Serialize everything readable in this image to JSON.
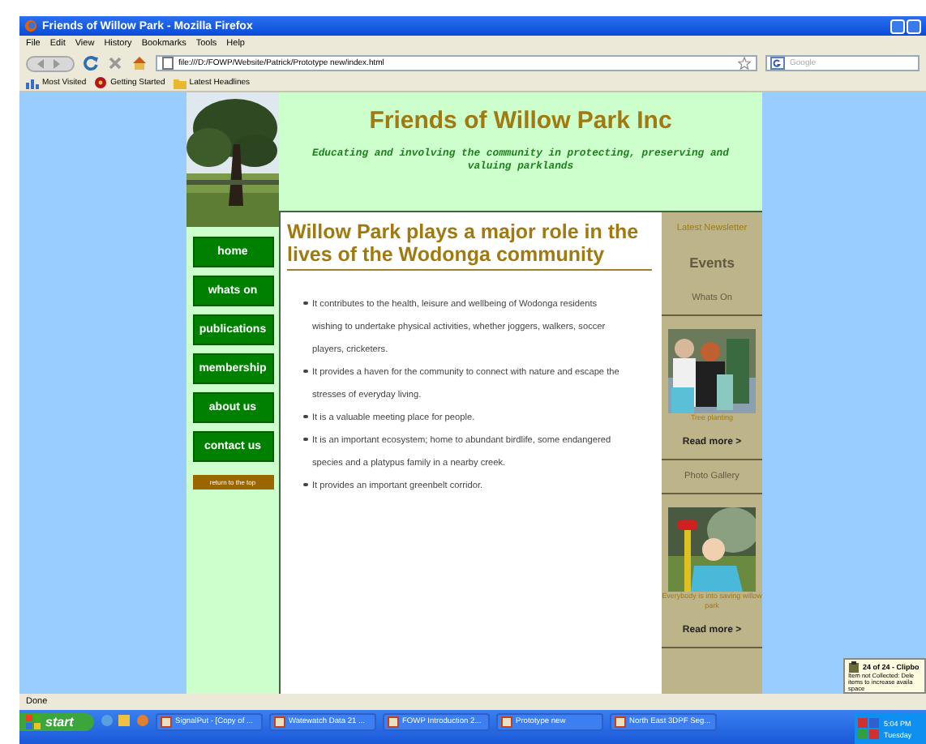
{
  "window": {
    "title": "Friends of Willow Park - Mozilla Firefox"
  },
  "menu": [
    "File",
    "Edit",
    "View",
    "History",
    "Bookmarks",
    "Tools",
    "Help"
  ],
  "address": {
    "value": "file:///D:/FOWP/Website/Patrick/Prototype new/index.html"
  },
  "search": {
    "placeholder": "Google"
  },
  "bookmarks": [
    {
      "label": "Most Visited",
      "kind": "chart"
    },
    {
      "label": "Getting Started",
      "kind": "flower"
    },
    {
      "label": "Latest Headlines",
      "kind": "folder"
    }
  ],
  "site": {
    "title": "Friends of Willow Park Inc",
    "tagline": "Educating and involving the community in protecting, preserving and valuing parklands",
    "nav": [
      {
        "label": "home",
        "kind": "main"
      },
      {
        "label": "whats on",
        "kind": "main"
      },
      {
        "label": "publications",
        "kind": "main"
      },
      {
        "label": "membership",
        "kind": "main"
      },
      {
        "label": "about us",
        "kind": "main"
      },
      {
        "label": "contact us",
        "kind": "main"
      },
      {
        "label": "return to the top",
        "kind": "small"
      }
    ],
    "heading": "Willow Park plays a major role in the lives of the Wodonga community",
    "bullets": [
      "It contributes to the health, leisure and wellbeing of Wodonga residents wishing to undertake physical activities, whether joggers, walkers, soccer players, cricketers.",
      "It provides a haven for the community to connect with nature and escape the stresses of everyday living.",
      "It is a valuable meeting place for people.",
      "It is an important ecosystem; home to abundant birdlife, some endangered species and a platypus family in a nearby creek.",
      "It provides an important greenbelt corridor."
    ],
    "sidebar": [
      {
        "kind": "link",
        "text": "Latest Newsletter"
      },
      {
        "kind": "big",
        "text": "Events"
      },
      {
        "kind": "plain",
        "text": "Whats On"
      },
      {
        "caption": "Tree planting"
      },
      {
        "kind": "more",
        "text": "Read more >"
      },
      {
        "kind": "plain",
        "text": "Photo Gallery"
      },
      {
        "caption": "Everybody is into saving willow park"
      },
      {
        "kind": "more",
        "text": "Read more >"
      }
    ]
  },
  "status_bar": "Done",
  "clipboard": {
    "title": "24 of 24 - Clipbo",
    "text": "Item not Collected: Dele items to increase availa space"
  },
  "taskbar": {
    "start": "start",
    "tasks": [
      "SignalPut - [Copy of ...",
      "Watewatch Data 21 ...",
      "FOWP Introduction 2...",
      "Prototype new",
      "North East 3DPF Seg..."
    ],
    "time": "5:04 PM",
    "day": "Tuesday"
  }
}
